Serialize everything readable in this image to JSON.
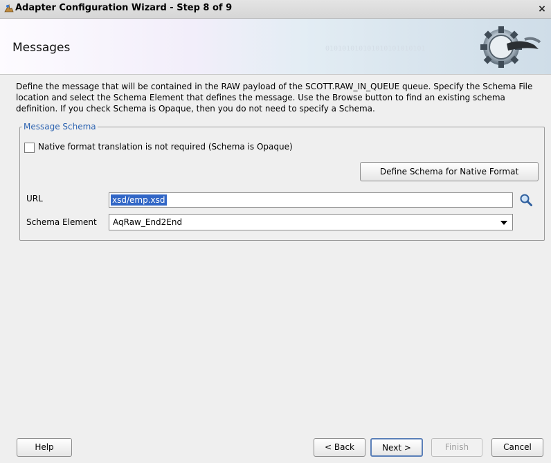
{
  "window": {
    "title": "Adapter Configuration Wizard - Step 8 of 9",
    "close": "×"
  },
  "header": {
    "title": "Messages",
    "binary_pattern": "010101010101010101010101"
  },
  "description": "Define the message that will be contained in the RAW payload of the SCOTT.RAW_IN_QUEUE queue.  Specify the Schema File location and select the Schema Element that defines the message. Use the Browse button to find an existing schema definition. If you check Schema is Opaque, then you do not need to specify a Schema.",
  "message_schema": {
    "legend": "Message Schema",
    "opaque_checkbox": {
      "label": "Native format translation is not required (Schema is Opaque)",
      "checked": false
    },
    "define_button": "Define Schema for Native Format",
    "url": {
      "label": "URL",
      "value": "xsd/emp.xsd"
    },
    "schema_element": {
      "label": "Schema Element",
      "value": "AqRaw_End2End"
    }
  },
  "footer": {
    "help": "Help",
    "back": "< Back",
    "next": "Next >",
    "finish": "Finish",
    "cancel": "Cancel"
  },
  "colors": {
    "legend_blue": "#2b62b0",
    "selection_blue": "#3166c6",
    "dialog_bg": "#efefef"
  },
  "icons": [
    "app-icon",
    "close-icon",
    "gear-icon",
    "search-icon",
    "chevron-down-icon"
  ]
}
